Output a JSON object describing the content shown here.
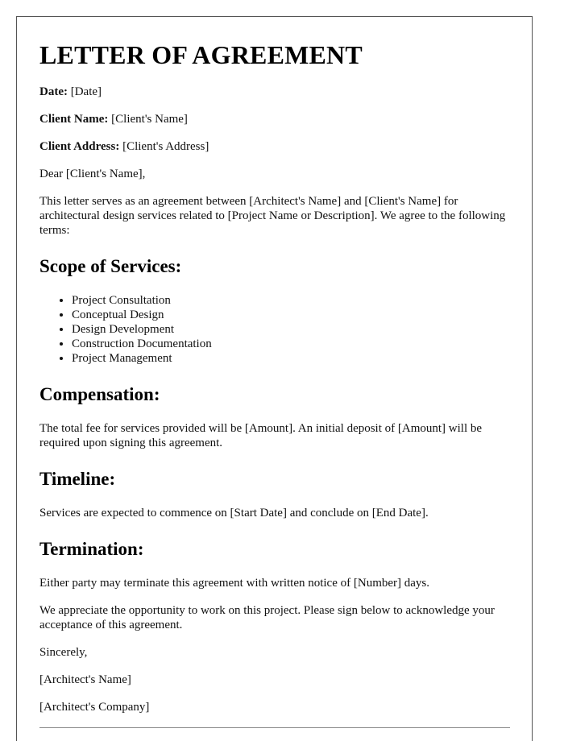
{
  "document": {
    "title": "LETTER OF AGREEMENT",
    "fields": [
      {
        "label": "Date:",
        "value": "[Date]"
      },
      {
        "label": "Client Name:",
        "value": "[Client's Name]"
      },
      {
        "label": "Client Address:",
        "value": "[Client's Address]"
      }
    ],
    "salutation": "Dear [Client's Name],",
    "intro": "This letter serves as an agreement between [Architect's Name] and [Client's Name] for architectural design services related to [Project Name or Description]. We agree to the following terms:",
    "sections": {
      "scope": {
        "heading": "Scope of Services:",
        "items": [
          "Project Consultation",
          "Conceptual Design",
          "Design Development",
          "Construction Documentation",
          "Project Management"
        ]
      },
      "compensation": {
        "heading": "Compensation:",
        "text": "The total fee for services provided will be [Amount]. An initial deposit of [Amount] will be required upon signing this agreement."
      },
      "timeline": {
        "heading": "Timeline:",
        "text": "Services are expected to commence on [Start Date] and conclude on [End Date]."
      },
      "termination": {
        "heading": "Termination:",
        "text": "Either party may terminate this agreement with written notice of [Number] days."
      }
    },
    "closing_text": "We appreciate the opportunity to work on this project. Please sign below to acknowledge your acceptance of this agreement.",
    "sign_off": "Sincerely,",
    "architect_name": "[Architect's Name]",
    "architect_company": "[Architect's Company]"
  }
}
